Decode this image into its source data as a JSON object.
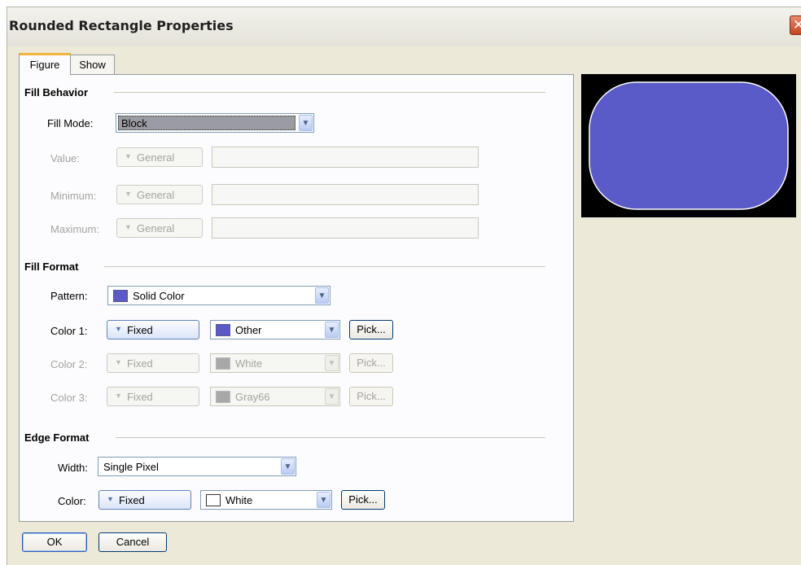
{
  "window": {
    "title": "Rounded Rectangle Properties",
    "close_icon": "close-icon"
  },
  "tabs": [
    {
      "label": "Figure"
    },
    {
      "label": "Show"
    }
  ],
  "fill_behavior": {
    "title": "Fill Behavior",
    "fill_mode": {
      "label": "Fill Mode:",
      "value": "Block"
    },
    "value": {
      "label": "Value:",
      "mode": "General"
    },
    "minimum": {
      "label": "Minimum:",
      "mode": "General"
    },
    "maximum": {
      "label": "Maximum:",
      "mode": "General"
    }
  },
  "fill_format": {
    "title": "Fill Format",
    "pattern": {
      "label": "Pattern:",
      "value": "Solid Color",
      "swatch_color": "#5a5ac8"
    },
    "color1": {
      "label": "Color 1:",
      "mode": "Fixed",
      "color": "Other",
      "swatch_color": "#5a5ac8",
      "pick": "Pick..."
    },
    "color2": {
      "label": "Color 2:",
      "mode": "Fixed",
      "color": "White",
      "swatch_color": "#a8a8a8",
      "pick": "Pick..."
    },
    "color3": {
      "label": "Color 3:",
      "mode": "Fixed",
      "color": "Gray66",
      "swatch_color": "#a8a8a8",
      "pick": "Pick..."
    }
  },
  "edge_format": {
    "title": "Edge Format",
    "width": {
      "label": "Width:",
      "value": "Single Pixel"
    },
    "color": {
      "label": "Color:",
      "mode": "Fixed",
      "color": "White",
      "swatch_color": "#ffffff",
      "pick": "Pick..."
    }
  },
  "buttons": {
    "ok": "OK",
    "cancel": "Cancel"
  },
  "preview": {
    "background": "#000000",
    "fill_color": "#5a5ac8",
    "edge_color": "#ffffff"
  }
}
